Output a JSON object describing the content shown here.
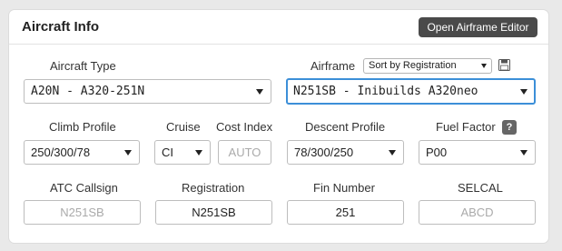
{
  "panel": {
    "title": "Aircraft Info",
    "editor_button": "Open Airframe Editor"
  },
  "aircraft_type": {
    "label": "Aircraft Type",
    "value": "A20N - A320-251N"
  },
  "airframe": {
    "label": "Airframe",
    "sort_option": "Sort by Registration",
    "value": "N251SB - Inibuilds A320neo"
  },
  "climb_profile": {
    "label": "Climb Profile",
    "value": "250/300/78"
  },
  "cruise": {
    "label": "Cruise",
    "value": "CI"
  },
  "cost_index": {
    "label": "Cost Index",
    "placeholder": "AUTO"
  },
  "descent_profile": {
    "label": "Descent Profile",
    "value": "78/300/250"
  },
  "fuel_factor": {
    "label": "Fuel Factor",
    "help": "?",
    "value": "P00"
  },
  "atc_callsign": {
    "label": "ATC Callsign",
    "placeholder": "N251SB"
  },
  "registration": {
    "label": "Registration",
    "value": "N251SB"
  },
  "fin_number": {
    "label": "Fin Number",
    "value": "251"
  },
  "selcal": {
    "label": "SELCAL",
    "placeholder": "ABCD"
  },
  "colors": {
    "focus": "#3c8fd8",
    "button_bg": "#4a4a4a"
  }
}
